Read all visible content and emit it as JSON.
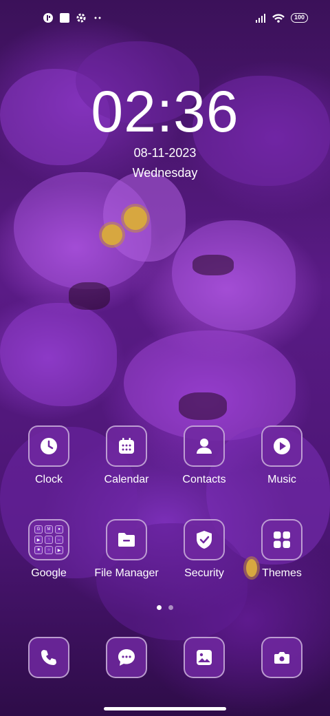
{
  "status_bar": {
    "left_icons": [
      "app-notification-icon",
      "square-notification-icon",
      "settings-icon",
      "more-dots-icon"
    ],
    "right_icons": [
      "signal-icon",
      "wifi-icon"
    ],
    "battery": "100"
  },
  "clock": {
    "time": "02:36",
    "date": "08-11-2023",
    "day": "Wednesday"
  },
  "apps_row1": [
    {
      "label": "Clock",
      "icon": "clock-icon"
    },
    {
      "label": "Calendar",
      "icon": "calendar-icon"
    },
    {
      "label": "Contacts",
      "icon": "contacts-icon"
    },
    {
      "label": "Music",
      "icon": "music-play-icon"
    }
  ],
  "apps_row2": [
    {
      "label": "Google",
      "icon": "google-folder-icon"
    },
    {
      "label": "File Manager",
      "icon": "folder-icon"
    },
    {
      "label": "Security",
      "icon": "shield-icon"
    },
    {
      "label": "Themes",
      "icon": "themes-grid-icon"
    }
  ],
  "google_folder_glyphs": [
    "G",
    "M",
    "●",
    "▶",
    "↑",
    "↔",
    "■",
    "○",
    "▶"
  ],
  "page_indicator": {
    "count": 2,
    "active": 0
  },
  "dock": [
    {
      "icon": "phone-icon"
    },
    {
      "icon": "messages-icon"
    },
    {
      "icon": "gallery-icon"
    },
    {
      "icon": "camera-icon"
    }
  ],
  "colors": {
    "tile_bg": "#7028a0",
    "tile_border": "#ffffff",
    "wallpaper_primary": "#8e36c7"
  }
}
